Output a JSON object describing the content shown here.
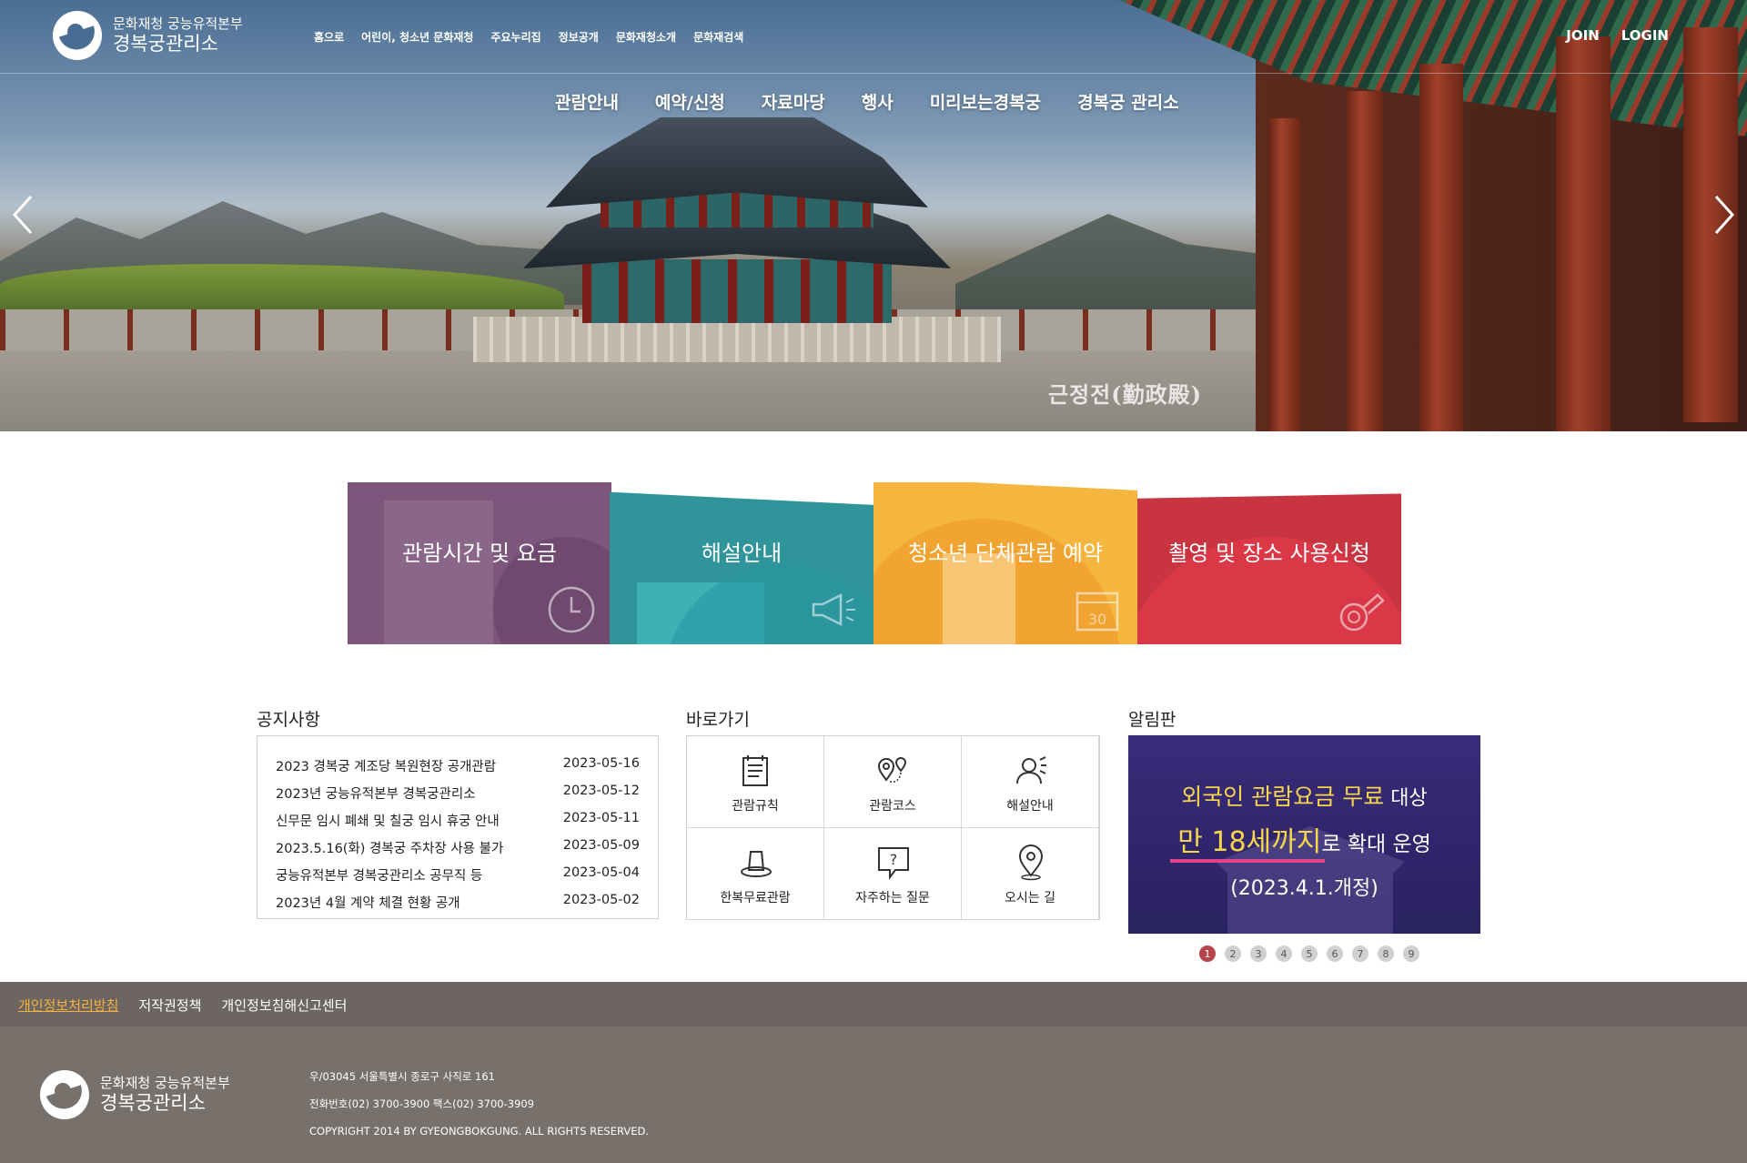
{
  "header": {
    "logo_sub": "문화재청 궁능유적본부",
    "logo_main": "경복궁관리소",
    "util_nav": [
      "홈으로",
      "어린이, 청소년 문화재청",
      "주요누리집",
      "정보공개",
      "문화재청소개",
      "문화재검색"
    ],
    "join": "JOIN",
    "login": "LOGIN",
    "gnb": [
      "관람안내",
      "예약/신청",
      "자료마당",
      "행사",
      "미리보는경복궁",
      "경복궁 관리소"
    ]
  },
  "hero": {
    "caption": "근정전(勤政殿)",
    "prev_icon": "chevron-left-icon",
    "next_icon": "chevron-right-icon"
  },
  "tiles": [
    {
      "label": "관람시간 및 요금",
      "icon": "clock-icon",
      "color": "#7d567b"
    },
    {
      "label": "해설안내",
      "icon": "megaphone-icon",
      "color": "#2f959a"
    },
    {
      "label": "청소년 단체관람 예약",
      "icon": "calendar-icon",
      "color": "#f4b63f"
    },
    {
      "label": "촬영 및 장소 사용신청",
      "icon": "camera-icon",
      "color": "#c8343f"
    }
  ],
  "notice": {
    "title": "공지사항",
    "items": [
      {
        "title": "2023 경복궁 계조당 복원현장 공개관람",
        "date": "2023-05-16"
      },
      {
        "title": "2023년 궁능유적본부 경복궁관리소",
        "date": "2023-05-12"
      },
      {
        "title": "신무문 임시 폐쇄 및 칠궁 임시 휴궁 안내",
        "date": "2023-05-11"
      },
      {
        "title": "2023.5.16(화) 경복궁 주차장 사용 불가",
        "date": "2023-05-09"
      },
      {
        "title": "궁능유적본부 경복궁관리소 공무직 등",
        "date": "2023-05-04"
      },
      {
        "title": "2023년 4월 계약 체결 현황 공개",
        "date": "2023-05-02"
      }
    ]
  },
  "quick": {
    "title": "바로가기",
    "items": [
      {
        "label": "관람규칙",
        "icon": "rules-icon"
      },
      {
        "label": "관람코스",
        "icon": "route-icon"
      },
      {
        "label": "해설안내",
        "icon": "guide-icon"
      },
      {
        "label": "한복무료관람",
        "icon": "hanbok-icon"
      },
      {
        "label": "자주하는 질문",
        "icon": "faq-icon"
      },
      {
        "label": "오시는 길",
        "icon": "location-icon"
      }
    ]
  },
  "board": {
    "title": "알림판",
    "line1_highlight": "외국인 관람요금 무료",
    "line1_rest": " 대상",
    "line2_highlight": "만 18세까지",
    "line2_rest": "로 확대 운영",
    "line3": "(2023.4.1.개정)",
    "pages": [
      "1",
      "2",
      "3",
      "4",
      "5",
      "6",
      "7",
      "8",
      "9"
    ],
    "active_page": "1"
  },
  "footer": {
    "links": [
      "개인정보처리방침",
      "저작권정책",
      "개인정보침해신고센터"
    ],
    "logo_sub": "문화재청 궁능유적본부",
    "logo_main": "경복궁관리소",
    "address": "우/03045 서울특별시 종로구 사직로 161",
    "phone": "전화번호(02) 3700-3900 팩스(02) 3700-3909",
    "copyright": "COPYRIGHT 2014 BY GYEONGBOKGUNG. ALL RIGHTS RESERVED."
  }
}
